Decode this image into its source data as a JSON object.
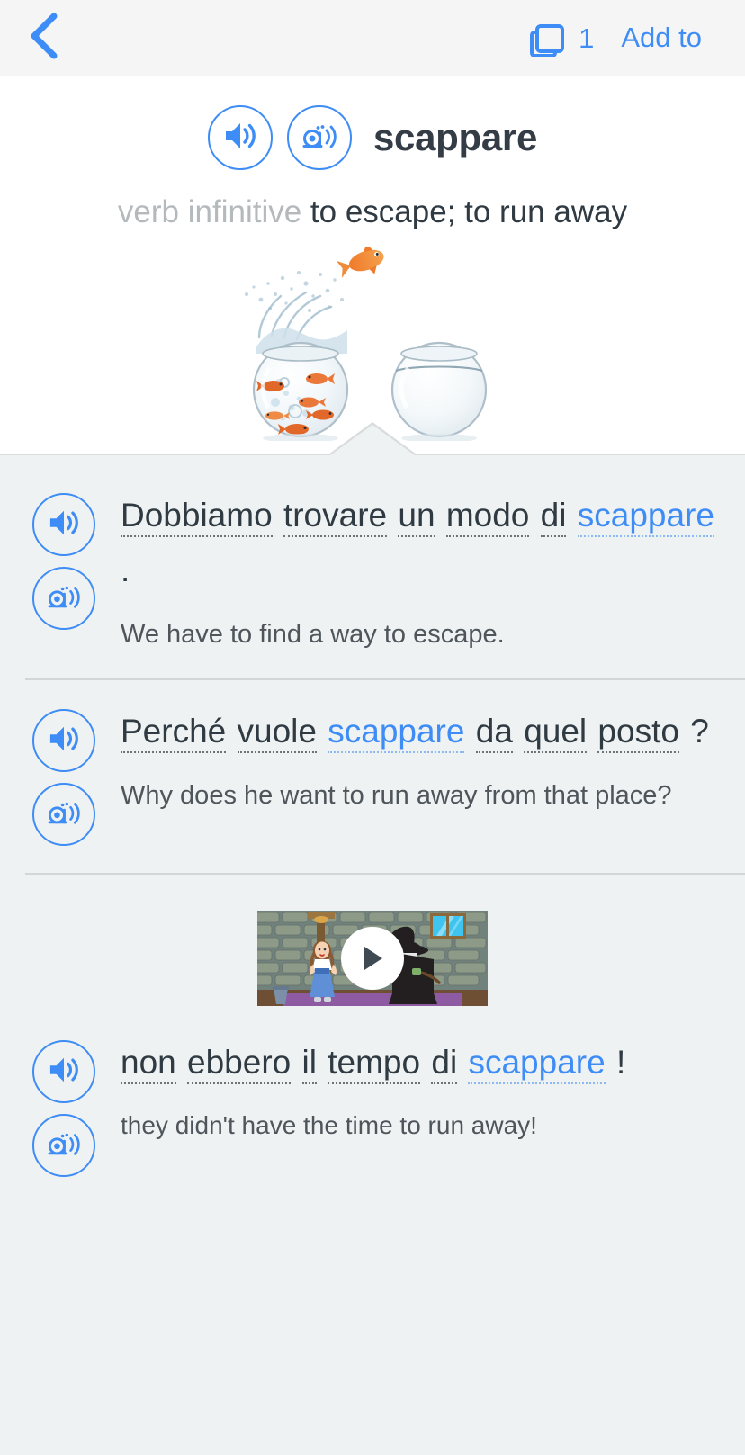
{
  "navbar": {
    "back_icon": "chevron-left-icon",
    "cards_icon": "cards-stack-icon",
    "cards_count": "1",
    "add_to_label": "Add to"
  },
  "entry": {
    "audio_icon": "speaker-icon",
    "slow_audio_icon": "snail-speaker-icon",
    "headword": "scappare",
    "part_of_speech": "verb infinitive",
    "definition": "to escape; to run away",
    "illustration_alt": "goldfish jumping out of a crowded fishbowl into an empty fishbowl"
  },
  "examples": [
    {
      "audio_icon": "speaker-icon",
      "slow_audio_icon": "snail-speaker-icon",
      "tokens": [
        {
          "text": "Dobbiamo",
          "highlight": false,
          "underline": true
        },
        {
          "text": "trovare",
          "highlight": false,
          "underline": true
        },
        {
          "text": "un",
          "highlight": false,
          "underline": true
        },
        {
          "text": "modo",
          "highlight": false,
          "underline": true
        },
        {
          "text": "di",
          "highlight": false,
          "underline": true
        },
        {
          "text": "scappare",
          "highlight": true,
          "underline": true
        },
        {
          "text": ".",
          "highlight": false,
          "underline": false
        }
      ],
      "translation": "We have to find a way to escape."
    },
    {
      "audio_icon": "speaker-icon",
      "slow_audio_icon": "snail-speaker-icon",
      "tokens": [
        {
          "text": "Perché",
          "highlight": false,
          "underline": true
        },
        {
          "text": "vuole",
          "highlight": false,
          "underline": true
        },
        {
          "text": "scappare",
          "highlight": true,
          "underline": true
        },
        {
          "text": "da",
          "highlight": false,
          "underline": true
        },
        {
          "text": "quel",
          "highlight": false,
          "underline": true
        },
        {
          "text": "posto",
          "highlight": false,
          "underline": true
        },
        {
          "text": "?",
          "highlight": false,
          "underline": false
        }
      ],
      "translation": "Why does he want to run away from that place?"
    },
    {
      "audio_icon": "speaker-icon",
      "slow_audio_icon": "snail-speaker-icon",
      "video": {
        "play_icon": "play-icon",
        "thumbnail_alt": "cartoon girl in blue dress and green witch in black hat inside a stone room"
      },
      "tokens": [
        {
          "text": "non",
          "highlight": false,
          "underline": true
        },
        {
          "text": "ebbero",
          "highlight": false,
          "underline": true
        },
        {
          "text": "il",
          "highlight": false,
          "underline": true
        },
        {
          "text": "tempo",
          "highlight": false,
          "underline": true
        },
        {
          "text": "di",
          "highlight": false,
          "underline": true
        },
        {
          "text": "scappare",
          "highlight": true,
          "underline": true
        },
        {
          "text": "!",
          "highlight": false,
          "underline": false
        }
      ],
      "translation": "they didn't have the time to run away!"
    }
  ],
  "colors": {
    "accent_blue": "#3e8cf5",
    "text_dark": "#2f3a42",
    "text_muted": "#b4b9bb",
    "page_background": "#eff2f2",
    "navbar_background": "#f5f5f5",
    "card_background": "#ffffff"
  }
}
